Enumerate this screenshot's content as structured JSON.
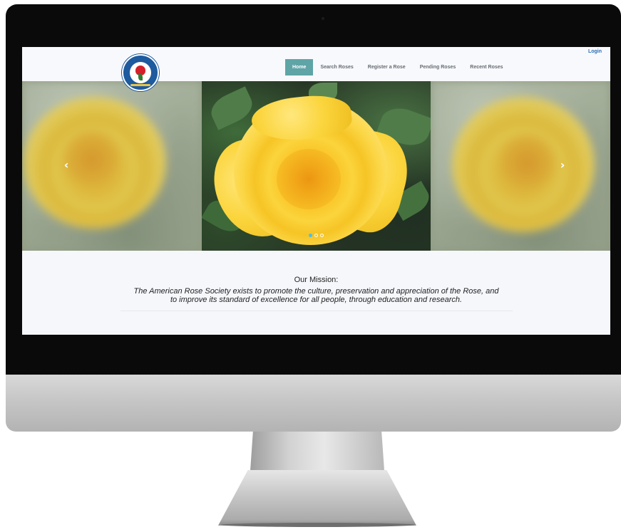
{
  "logo": {
    "alt_text": "AMERICAN ROSE SOCIETY"
  },
  "nav": {
    "items": [
      {
        "label": "Home",
        "active": true
      },
      {
        "label": "Search Roses",
        "active": false
      },
      {
        "label": "Register a Rose",
        "active": false
      },
      {
        "label": "Pending Roses",
        "active": false
      },
      {
        "label": "Recent Roses",
        "active": false
      }
    ],
    "login": "Login"
  },
  "carousel": {
    "prev_icon": "chevron-left-icon",
    "next_icon": "chevron-right-icon",
    "slide_count": 3,
    "active_index": 0
  },
  "mission": {
    "title": "Our Mission:",
    "line1": "The American Rose Society exists to promote the culture, preservation and appreciation of the Rose, and",
    "line2": "to improve its standard of excellence for all people, through education and research."
  },
  "colors": {
    "nav_active": "#5fa4a7",
    "login_link": "#2e6fb3",
    "indicator_active": "#4ac0e8"
  }
}
